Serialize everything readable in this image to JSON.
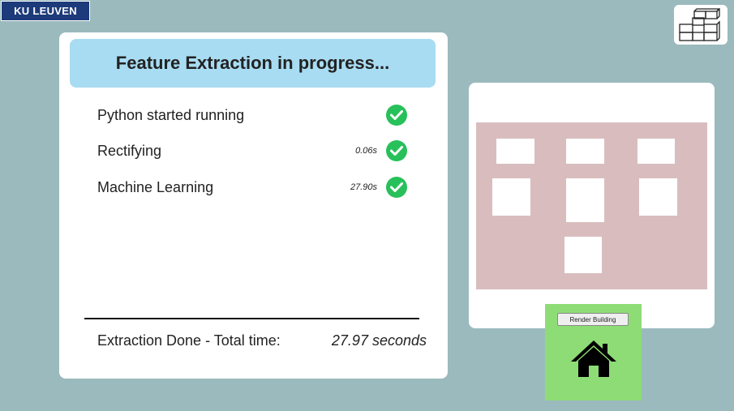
{
  "logo": {
    "text": "KU LEUVEN"
  },
  "toolbar": {
    "icon": "building-blocks-icon"
  },
  "progress": {
    "title": "Feature Extraction in progress...",
    "steps": [
      {
        "label": "Python started running",
        "time": "",
        "status": "done"
      },
      {
        "label": "Rectifying",
        "time": "0.06s",
        "status": "done"
      },
      {
        "label": "Machine Learning",
        "time": "27.90s",
        "status": "done"
      }
    ],
    "total_label": "Extraction Done - Total time:",
    "total_value": "27.97 seconds"
  },
  "colors": {
    "background": "#9bbabd",
    "title_bar": "#a8dcf2",
    "check": "#27c05a",
    "facade": "#d9bdbe",
    "render_panel": "#8edc75",
    "logo": "#1d3a7a"
  },
  "render": {
    "button_label": "Render Building",
    "icon": "home-icon"
  }
}
